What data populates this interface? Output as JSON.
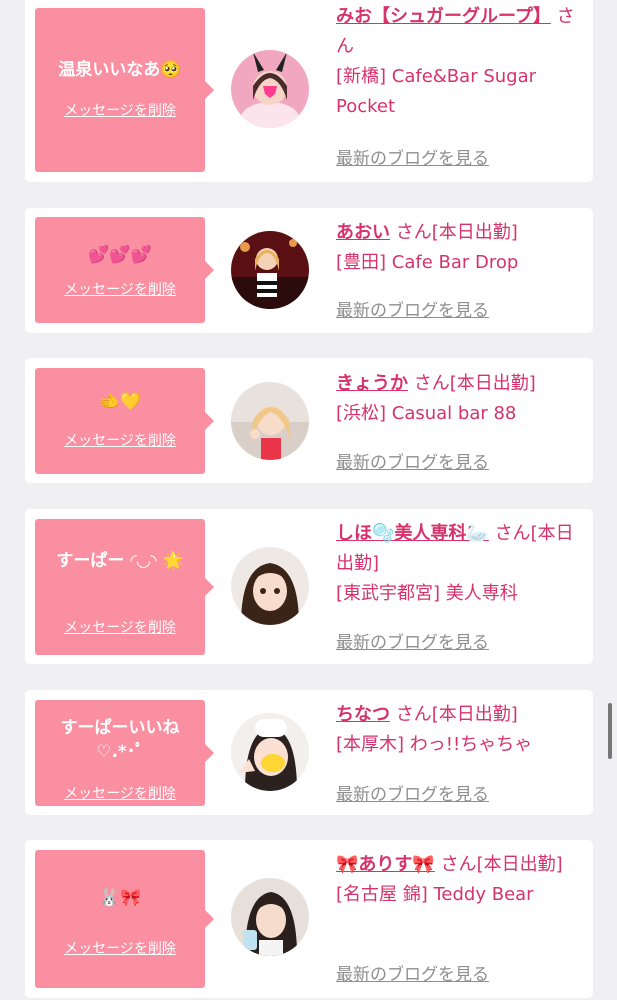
{
  "cards": [
    {
      "message": "温泉いいなあ🥺",
      "delete_label": "メッセージを削除",
      "name": "みお【シュガーグループ】",
      "honorific": "さん",
      "status": "",
      "shop": "[新橋] Cafe&Bar Sugar Pocket",
      "blog_label": "最新のブログを見る"
    },
    {
      "message": "💕💕💕",
      "delete_label": "メッセージを削除",
      "name": "あおい",
      "honorific": "さん",
      "status": "[本日出勤]",
      "shop": "[豊田] Cafe Bar Drop",
      "blog_label": "最新のブログを見る"
    },
    {
      "message": "🫲💛",
      "delete_label": "メッセージを削除",
      "name": "きょうか",
      "honorific": "さん",
      "status": "[本日出勤]",
      "shop": "[浜松] Casual bar 88",
      "blog_label": "最新のブログを見る"
    },
    {
      "message": "すーぱー ◜◡◝ 🌟",
      "delete_label": "メッセージを削除",
      "name": "しほ🫧美人専科🦢",
      "honorific": "さん",
      "status": "[本日出勤]",
      "shop": "[東武宇都宮] 美人専科",
      "blog_label": "最新のブログを見る"
    },
    {
      "message": "すーぱーいいね ♡.*･ﾟ",
      "delete_label": "メッセージを削除",
      "name": "ちなつ",
      "honorific": "さん",
      "status": "[本日出勤]",
      "shop": "[本厚木] わっ!!ちゃちゃ",
      "blog_label": "最新のブログを見る"
    },
    {
      "message": "🐰🎀",
      "delete_label": "メッセージを削除",
      "name": "🎀ありす🎀",
      "honorific": "さん",
      "status": "[本日出勤]",
      "shop": "[名古屋 錦] Teddy Bear",
      "blog_label": "最新のブログを見る"
    }
  ],
  "colors": {
    "background": "#f0f0f2",
    "bubble": "#f98fa1",
    "accent": "#d6336c",
    "muted": "#8f8f8f"
  }
}
